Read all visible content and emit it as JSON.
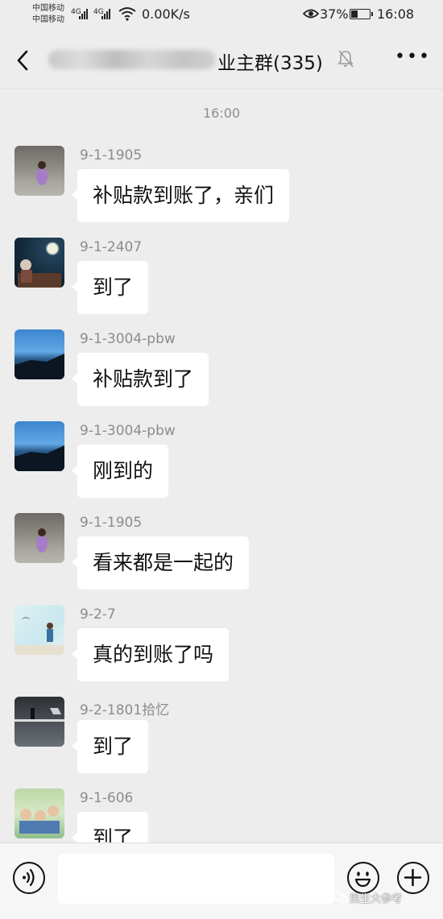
{
  "status_bar": {
    "carrier1": "中国移动",
    "carrier2": "中国移动",
    "network1": "4G",
    "network2": "4G",
    "net_speed": "0.00K/s",
    "battery_pct": "37%",
    "battery_level": 0.37,
    "time": "16:08"
  },
  "header": {
    "title": "业主群(335)",
    "back_icon": "chevron-left-icon",
    "mute_icon": "bell-off-icon",
    "more_icon": "more-icon"
  },
  "chat": {
    "time_label": "16:00",
    "messages": [
      {
        "sender": "9-1-1905",
        "text": "补贴款到账了，亲们"
      },
      {
        "sender": "9-1-2407",
        "text": "到了"
      },
      {
        "sender": "9-1-3004-pbw",
        "text": "补贴款到了"
      },
      {
        "sender": "9-1-3004-pbw",
        "text": "刚到的"
      },
      {
        "sender": "9-1-1905",
        "text": "看来都是一起的"
      },
      {
        "sender": "9-2-7",
        "text": "真的到账了吗"
      },
      {
        "sender": "9-2-1801拾忆",
        "text": "到了"
      },
      {
        "sender": "9-1-606",
        "text": "到了"
      }
    ]
  },
  "input_bar": {
    "voice_icon": "voice-icon",
    "emoji_icon": "emoji-icon",
    "plus_icon": "plus-icon",
    "watermark": "民生大参考"
  }
}
